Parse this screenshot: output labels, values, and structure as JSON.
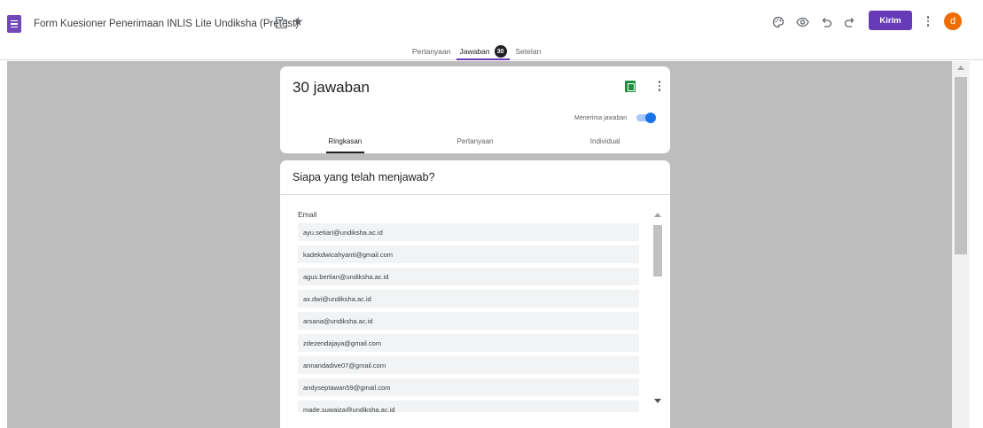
{
  "header": {
    "title": "Form Kuesioner Penerimaan INLIS Lite Undiksha (Pretest)",
    "send_label": "Kirim",
    "avatar_letter": "d",
    "icons": [
      "palette-icon",
      "preview-eye-icon",
      "undo-icon",
      "redo-icon",
      "more-vert-icon"
    ]
  },
  "tabs": [
    {
      "label": "Pertanyaan"
    },
    {
      "label": "Jawaban",
      "badge": "30"
    },
    {
      "label": "Setelan"
    }
  ],
  "summary": {
    "count_label": "30 jawaban",
    "accepting_label": "Menerima jawaban",
    "accepting_on": true,
    "subtabs": [
      "Ringkasan",
      "Pertanyaan",
      "Individual"
    ]
  },
  "respondents": {
    "title": "Siapa yang telah menjawab?",
    "column_header": "Email",
    "emails": [
      "ayu.setiari@undiksha.ac.id",
      "kadekdwicahyanti@gmail.com",
      "agus.berlian@undiksha.ac.id",
      "ax.dwi@undiksha.ac.id",
      "arsana@undiksha.ac.id",
      "zdezendajaya@gmail.com",
      "annandadive07@gmail.com",
      "andyseptawan59@gmail.com",
      "made.suwaiza@undiksha.ac.id"
    ]
  },
  "colors": {
    "accent": "#673ab7",
    "avatar": "#ef6c00",
    "toggle": "#1a73e8",
    "sheets": "#1e8e3e"
  }
}
